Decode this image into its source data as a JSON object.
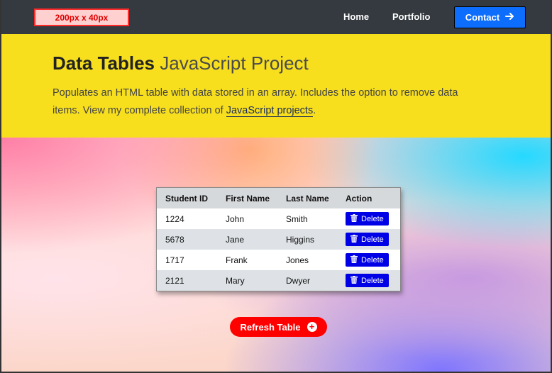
{
  "nav": {
    "logo_label": "200px x 40px",
    "links": [
      "Home",
      "Portfolio"
    ],
    "contact_label": "Contact"
  },
  "header": {
    "title_strong": "Data Tables",
    "title_light": " JavaScript Project",
    "desc_text": "Populates an HTML table with data stored in an array. Includes the option to remove data items. View my complete collection of ",
    "desc_link": "JavaScript projects",
    "desc_end": "."
  },
  "table": {
    "headers": [
      "Student ID",
      "First Name",
      "Last Name",
      "Action"
    ],
    "rows": [
      {
        "id": "1224",
        "first": "John",
        "last": "Smith",
        "action": "Delete"
      },
      {
        "id": "5678",
        "first": "Jane",
        "last": "Higgins",
        "action": "Delete"
      },
      {
        "id": "1717",
        "first": "Frank",
        "last": "Jones",
        "action": "Delete"
      },
      {
        "id": "2121",
        "first": "Mary",
        "last": "Dwyer",
        "action": "Delete"
      }
    ]
  },
  "refresh_label": "Refresh Table",
  "colors": {
    "navbar": "#343a40",
    "header": "#f7df1e",
    "contact": "#0d6efd",
    "delete": "#0000e6",
    "refresh": "#ff0000"
  }
}
